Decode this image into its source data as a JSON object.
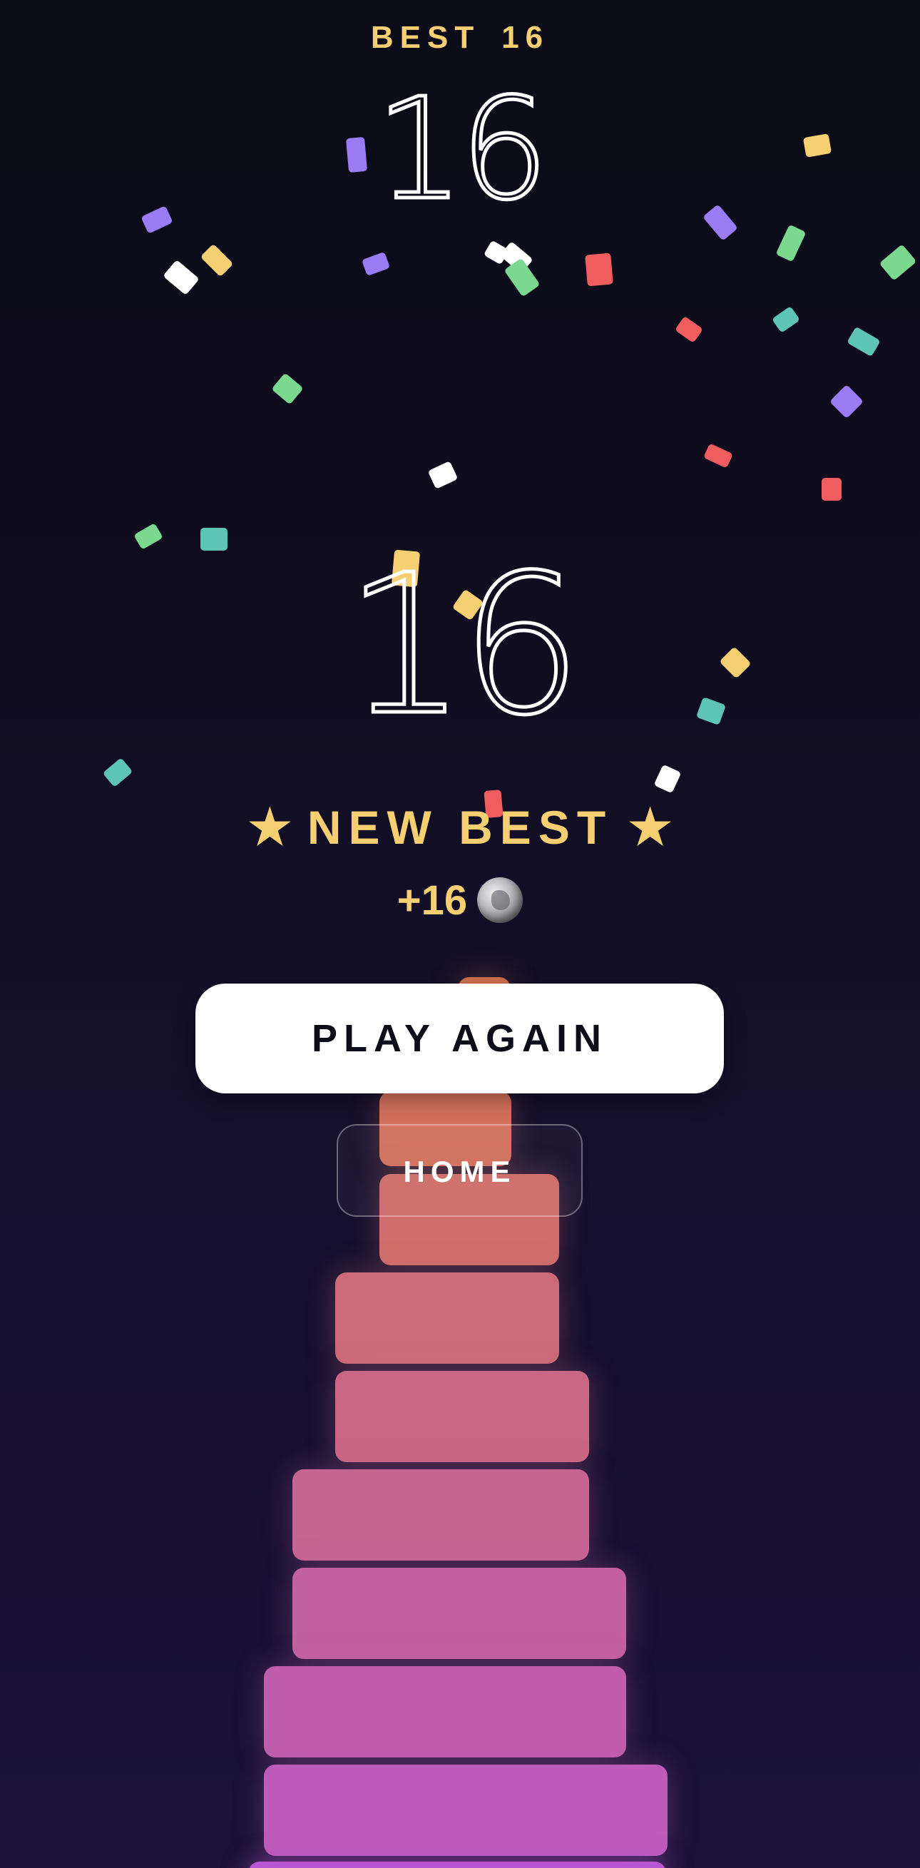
{
  "header": {
    "best_label": "BEST",
    "best_value": "16"
  },
  "score": {
    "current_top": "16",
    "current_big": "16"
  },
  "result": {
    "new_best_label": "NEW BEST",
    "star_glyph": "★",
    "reward_text": "+16",
    "reward_icon": "coin-icon"
  },
  "buttons": {
    "play_again": "PLAY AGAIN",
    "home": "HOME"
  },
  "tower": {
    "visible_block_count": 11,
    "gradient_top_color": "#d4734e",
    "gradient_bottom_color": "#b855d6"
  },
  "confetti_colors": [
    "#f6cf72",
    "#9b7cf4",
    "#f05d5e",
    "#7bd88f",
    "#5ec4b6",
    "#ffffff"
  ],
  "colors": {
    "accent_gold": "#f6cf72",
    "background": "#100d20",
    "button_primary": "#ffffff"
  }
}
